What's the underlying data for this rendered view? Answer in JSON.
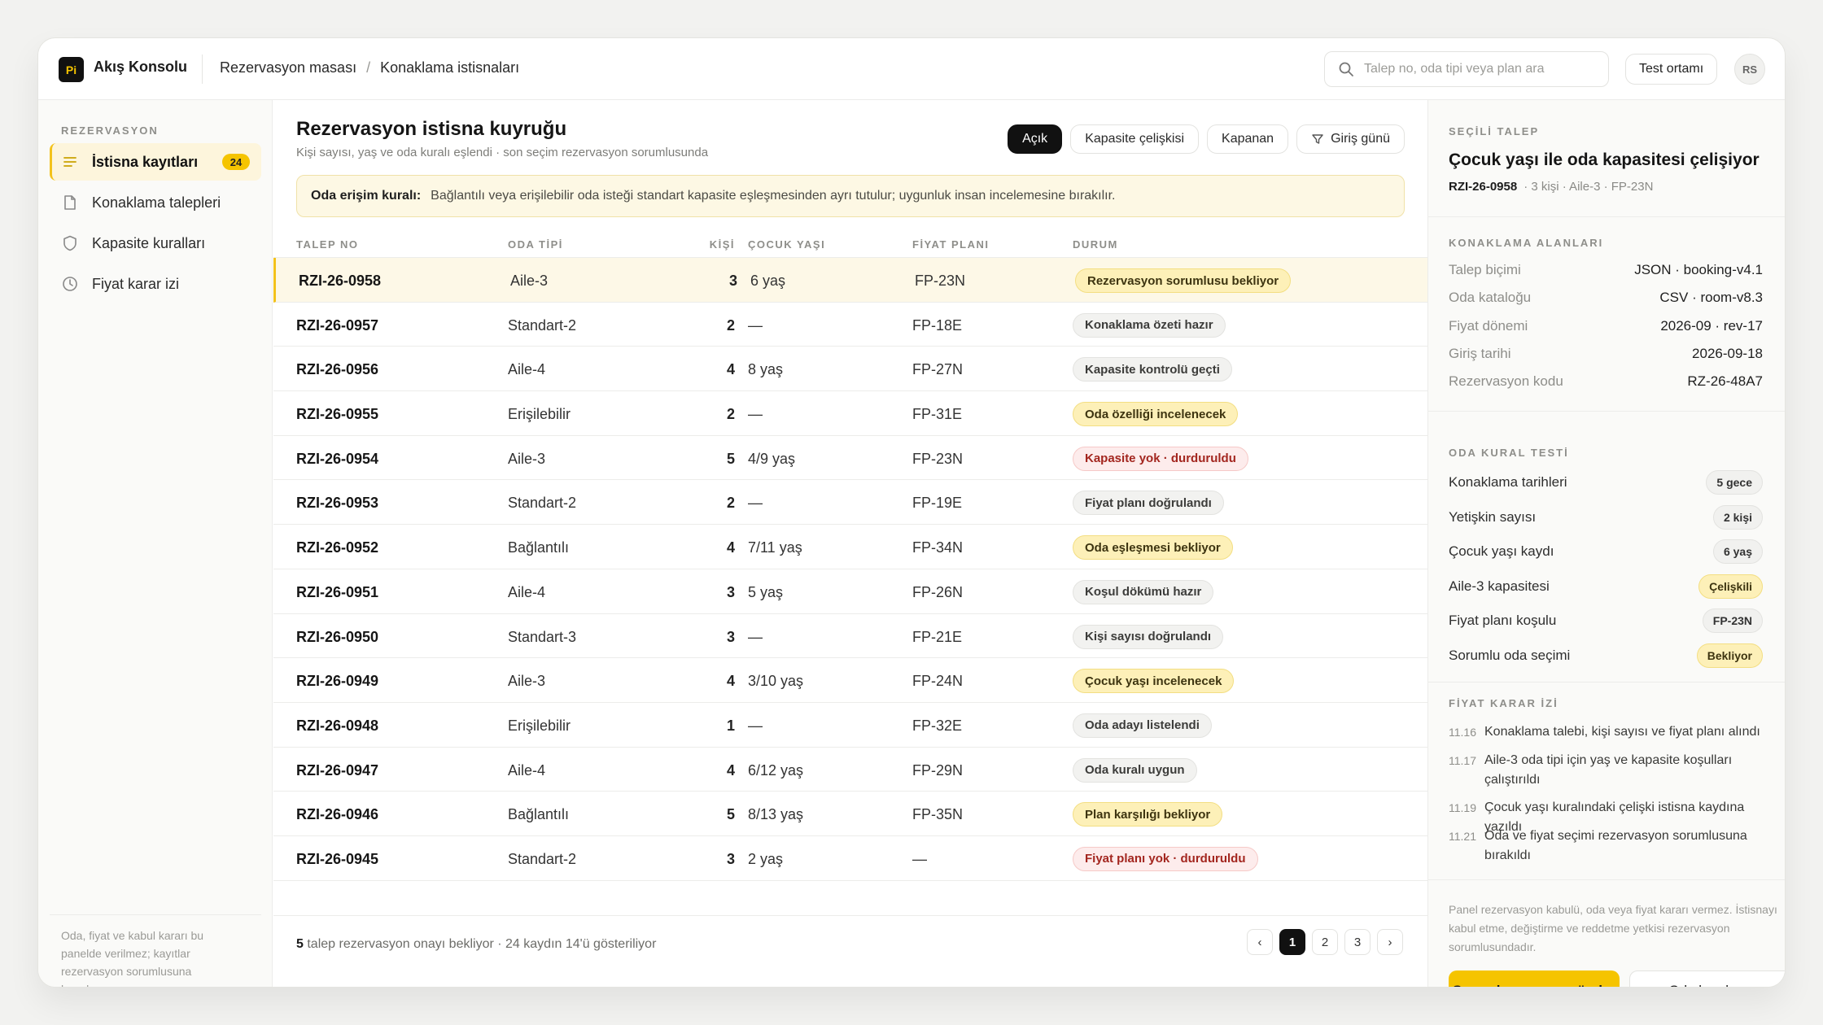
{
  "app": {
    "logo": "Pi",
    "title": "Akış Konsolu"
  },
  "breadcrumb": [
    "Rezervasyon masası",
    "Konaklama istisnaları"
  ],
  "search": {
    "placeholder": "Talep no, oda tipi veya plan ara",
    "icon": "search-icon"
  },
  "header": {
    "env_label": "Test ortamı",
    "avatar": "RS"
  },
  "sidebar": {
    "heading": "REZERVASYON",
    "items": [
      {
        "label": "İstisna kayıtları",
        "icon": "list-icon",
        "count": "24",
        "active": true
      },
      {
        "label": "Konaklama talepleri",
        "icon": "document-icon"
      },
      {
        "label": "Kapasite kuralları",
        "icon": "shield-icon"
      },
      {
        "label": "Fiyat karar izi",
        "icon": "clock-icon"
      }
    ],
    "note": "Oda, fiyat ve kabul kararı bu panelde verilmez; kayıtlar rezervasyon sorumlusuna hazırlanır."
  },
  "main": {
    "title": "Rezervasyon istisna kuyruğu",
    "subtitle": "Kişi sayısı, yaş ve oda kuralı eşlendi · son seçim rezervasyon sorumlusunda",
    "filters": [
      "Açık",
      "Kapasite çelişkisi",
      "Kapanan",
      "Giriş günü"
    ],
    "rule": {
      "label": "Oda erişim kuralı:",
      "text": "Bağlantılı veya erişilebilir oda isteği standart kapasite eşleşmesinden ayrı tutulur; uygunluk insan incelemesine bırakılır."
    },
    "columns": [
      "TALEP NO",
      "ODA TİPİ",
      "KİŞİ",
      "ÇOCUK YAŞI",
      "FİYAT PLANI",
      "DURUM"
    ],
    "rows": [
      {
        "id": "RZI-26-0958",
        "room": "Aile-3",
        "people": "3",
        "child": "6 yaş",
        "plan": "FP-23N",
        "status": "Rezervasyon sorumlusu bekliyor",
        "tone": "yellow"
      },
      {
        "id": "RZI-26-0957",
        "room": "Standart-2",
        "people": "2",
        "child": "—",
        "plan": "FP-18E",
        "status": "Konaklama özeti hazır",
        "tone": "gray"
      },
      {
        "id": "RZI-26-0956",
        "room": "Aile-4",
        "people": "4",
        "child": "8 yaş",
        "plan": "FP-27N",
        "status": "Kapasite kontrolü geçti",
        "tone": "gray"
      },
      {
        "id": "RZI-26-0955",
        "room": "Erişilebilir",
        "people": "2",
        "child": "—",
        "plan": "FP-31E",
        "status": "Oda özelliği incelenecek",
        "tone": "yellow"
      },
      {
        "id": "RZI-26-0954",
        "room": "Aile-3",
        "people": "5",
        "child": "4/9 yaş",
        "plan": "FP-23N",
        "status": "Kapasite yok · durduruldu",
        "tone": "red"
      },
      {
        "id": "RZI-26-0953",
        "room": "Standart-2",
        "people": "2",
        "child": "—",
        "plan": "FP-19E",
        "status": "Fiyat planı doğrulandı",
        "tone": "gray"
      },
      {
        "id": "RZI-26-0952",
        "room": "Bağlantılı",
        "people": "4",
        "child": "7/11 yaş",
        "plan": "FP-34N",
        "status": "Oda eşleşmesi bekliyor",
        "tone": "yellow"
      },
      {
        "id": "RZI-26-0951",
        "room": "Aile-4",
        "people": "3",
        "child": "5 yaş",
        "plan": "FP-26N",
        "status": "Koşul dökümü hazır",
        "tone": "gray"
      },
      {
        "id": "RZI-26-0950",
        "room": "Standart-3",
        "people": "3",
        "child": "—",
        "plan": "FP-21E",
        "status": "Kişi sayısı doğrulandı",
        "tone": "gray"
      },
      {
        "id": "RZI-26-0949",
        "room": "Aile-3",
        "people": "4",
        "child": "3/10 yaş",
        "plan": "FP-24N",
        "status": "Çocuk yaşı incelenecek",
        "tone": "yellow"
      },
      {
        "id": "RZI-26-0948",
        "room": "Erişilebilir",
        "people": "1",
        "child": "—",
        "plan": "FP-32E",
        "status": "Oda adayı listelendi",
        "tone": "gray"
      },
      {
        "id": "RZI-26-0947",
        "room": "Aile-4",
        "people": "4",
        "child": "6/12 yaş",
        "plan": "FP-29N",
        "status": "Oda kuralı uygun",
        "tone": "gray"
      },
      {
        "id": "RZI-26-0946",
        "room": "Bağlantılı",
        "people": "5",
        "child": "8/13 yaş",
        "plan": "FP-35N",
        "status": "Plan karşılığı bekliyor",
        "tone": "yellow"
      },
      {
        "id": "RZI-26-0945",
        "room": "Standart-2",
        "people": "3",
        "child": "2 yaş",
        "plan": "—",
        "status": "Fiyat planı yok · durduruldu",
        "tone": "red"
      }
    ],
    "footer": {
      "count": "5",
      "text": " talep rezervasyon onayı bekliyor · 24 kaydın 14'ü gösteriliyor"
    },
    "pager": {
      "prev": "‹",
      "pages": [
        "1",
        "2",
        "3"
      ],
      "next": "›"
    }
  },
  "panel": {
    "heading": "SEÇİLİ TALEP",
    "title": "Çocuk yaşı ile oda kapasitesi çelişiyor",
    "id": "RZI-26-0958",
    "meta": "· 3 kişi · Aile-3 · FP-23N",
    "fields_heading": "KONAKLAMA ALANLARI",
    "fields": [
      {
        "k": "Talep biçimi",
        "v": "JSON · booking-v4.1"
      },
      {
        "k": "Oda kataloğu",
        "v": "CSV · room-v8.3"
      },
      {
        "k": "Fiyat dönemi",
        "v": "2026-09 · rev-17"
      },
      {
        "k": "Giriş tarihi",
        "v": "2026-09-18"
      },
      {
        "k": "Rezervasyon kodu",
        "v": "RZ-26-48A7"
      }
    ],
    "tests_heading": "ODA KURAL TESTİ",
    "tests": [
      {
        "k": "Konaklama tarihleri",
        "v": "5 gece",
        "tone": "gray"
      },
      {
        "k": "Yetişkin sayısı",
        "v": "2 kişi",
        "tone": "gray"
      },
      {
        "k": "Çocuk yaşı kaydı",
        "v": "6 yaş",
        "tone": "gray"
      },
      {
        "k": "Aile-3 kapasitesi",
        "v": "Çelişkili",
        "tone": "yellow"
      },
      {
        "k": "Fiyat planı koşulu",
        "v": "FP-23N",
        "tone": "gray"
      },
      {
        "k": "Sorumlu oda seçimi",
        "v": "Bekliyor",
        "tone": "yellow"
      }
    ],
    "trail_heading": "FİYAT KARAR İZİ",
    "trail": [
      {
        "t": "11.16",
        "m": "Konaklama talebi, kişi sayısı ve fiyat planı alındı"
      },
      {
        "t": "11.17",
        "m": "Aile-3 oda tipi için yaş ve kapasite koşulları çalıştırıldı"
      },
      {
        "t": "11.19",
        "m": "Çocuk yaşı kuralındaki çelişki istisna kaydına yazıldı"
      },
      {
        "t": "11.21",
        "m": "Oda ve fiyat seçimi rezervasyon sorumlusuna bırakıldı"
      }
    ],
    "note": "Panel rezervasyon kabulü, oda veya fiyat kararı vermez. İstisnayı kabul etme, değiştirme ve reddetme yetkisi rezervasyon sorumlusundadır.",
    "primary_button": "Sorumlu onayına gönder",
    "secondary_button": "Oda kuralını aç"
  }
}
